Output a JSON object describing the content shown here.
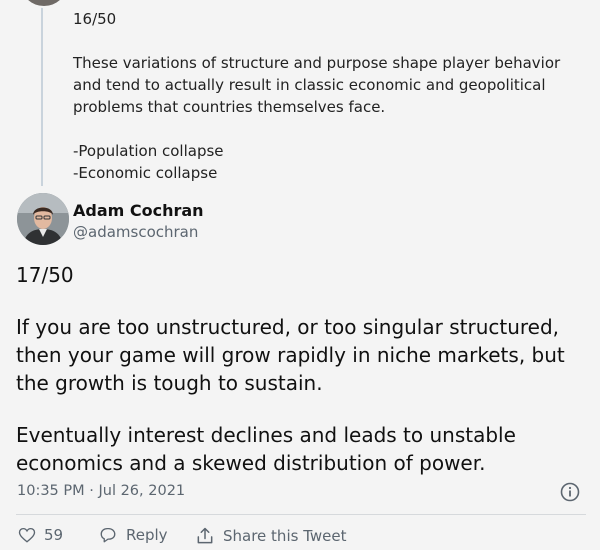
{
  "previous_tweet": {
    "counter": "16/50",
    "body": "These variations of structure and purpose shape player behavior and tend to actually result in classic economic and geopolitical problems that countries themselves face.",
    "list": [
      "-Population collapse",
      "-Economic collapse"
    ]
  },
  "author": {
    "name": "Adam Cochran",
    "handle": "@adamscochran",
    "avatar_icon": "avatar"
  },
  "tweet": {
    "counter": "17/50",
    "paragraph_1": "If you are too unstructured, or too singular structured, then your game will grow rapidly in niche markets, but the growth is tough to sustain.",
    "paragraph_2": "Eventually interest declines and leads to unstable economics and a skewed distribution of power.",
    "timestamp": "10:35 PM · Jul 26, 2021"
  },
  "actions": {
    "like_count": "59",
    "reply_label": "Reply",
    "share_label": "Share this Tweet"
  },
  "colors": {
    "background": "#f4f4f4",
    "secondary_text": "#5c6670",
    "thread_line": "#c9d3dc"
  }
}
